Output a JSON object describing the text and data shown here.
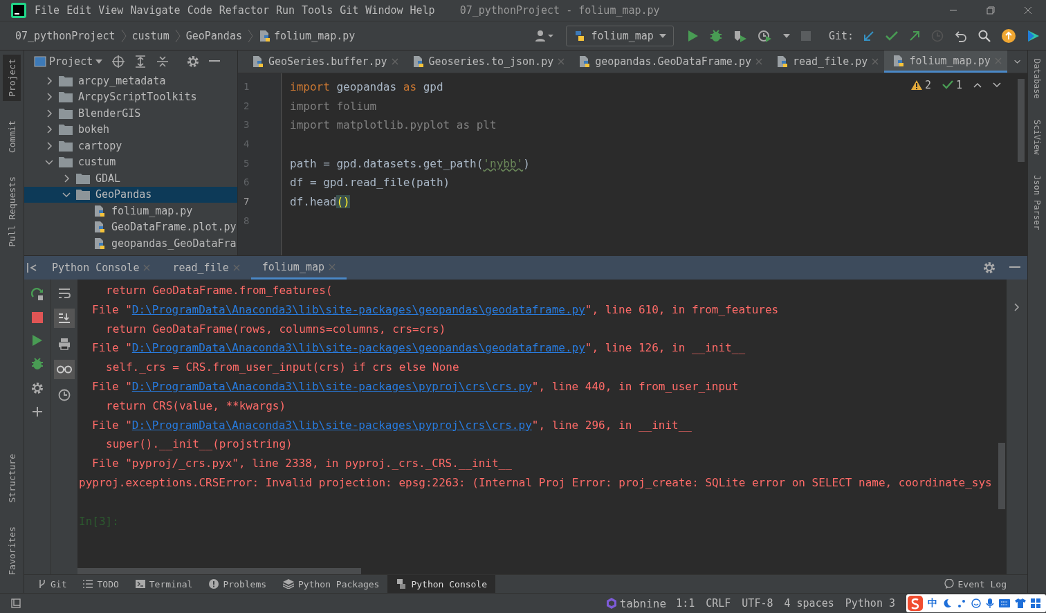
{
  "window": {
    "title": "07_pythonProject - folium_map.py"
  },
  "menu": [
    "File",
    "Edit",
    "View",
    "Navigate",
    "Code",
    "Refactor",
    "Run",
    "Tools",
    "Git",
    "Window",
    "Help"
  ],
  "breadcrumbs": [
    {
      "label": "07_pythonProject",
      "kind": "folder"
    },
    {
      "label": "custum",
      "kind": "folder"
    },
    {
      "label": "GeoPandas",
      "kind": "folder"
    },
    {
      "label": "folium_map.py",
      "kind": "file"
    }
  ],
  "run_config": {
    "label": "folium_map"
  },
  "git_label": "Git:",
  "left_strip_top": [
    {
      "label": "Project",
      "selected": true
    },
    {
      "label": "Commit",
      "selected": false
    },
    {
      "label": "Pull Requests",
      "selected": false
    }
  ],
  "left_strip_bottom": [
    {
      "label": "Structure",
      "selected": false
    },
    {
      "label": "Favorites",
      "selected": false
    }
  ],
  "right_strip": [
    {
      "label": "Database"
    },
    {
      "label": "SciView"
    },
    {
      "label": "Json Parser"
    }
  ],
  "project_panel": {
    "title": "Project",
    "tree": [
      {
        "label": "arcpy_metadata",
        "kind": "folder",
        "expanded": false,
        "selected": false
      },
      {
        "label": "ArcpyScriptToolkits",
        "kind": "folder",
        "expanded": false,
        "selected": false
      },
      {
        "label": "BlenderGIS",
        "kind": "folder",
        "expanded": false,
        "selected": false
      },
      {
        "label": "bokeh",
        "kind": "folder",
        "expanded": false,
        "selected": false
      },
      {
        "label": "cartopy",
        "kind": "folder",
        "expanded": false,
        "selected": false
      },
      {
        "label": "custum",
        "kind": "folder",
        "expanded": true,
        "selected": false,
        "children": [
          {
            "label": "GDAL",
            "kind": "folder",
            "expanded": false,
            "selected": false
          },
          {
            "label": "GeoPandas",
            "kind": "folder",
            "expanded": true,
            "selected": true,
            "children": [
              {
                "label": "folium_map.py",
                "kind": "file",
                "selected": false
              },
              {
                "label": "GeoDataFrame.plot.py",
                "kind": "file",
                "selected": false
              },
              {
                "label": "geopandas_GeoDataFra",
                "kind": "file",
                "selected": false
              }
            ]
          }
        ]
      }
    ]
  },
  "editor": {
    "tabs": [
      {
        "label": "GeoSeries.buffer.py",
        "selected": false
      },
      {
        "label": "Geoseries.to_json.py",
        "selected": false
      },
      {
        "label": "geopandas.GeoDataFrame.py",
        "selected": false
      },
      {
        "label": "read_file.py",
        "selected": false
      },
      {
        "label": "folium_map.py",
        "selected": true
      }
    ],
    "warnings": "2",
    "weak_warnings": "1",
    "lines": [
      {
        "number": "1",
        "current": false,
        "tokens": [
          {
            "t": "import",
            "kind": "keyword"
          },
          {
            "t": " geopandas ",
            "kind": "plain"
          },
          {
            "t": "as",
            "kind": "keyword"
          },
          {
            "t": " gpd",
            "kind": "plain"
          }
        ]
      },
      {
        "number": "2",
        "current": false,
        "tokens": [
          {
            "t": "import folium",
            "kind": "unused"
          }
        ]
      },
      {
        "number": "3",
        "current": false,
        "tokens": [
          {
            "t": "import matplotlib.pyplot as plt",
            "kind": "unused"
          }
        ]
      },
      {
        "number": "4",
        "current": false
      },
      {
        "number": "5",
        "current": false,
        "tokens": [
          {
            "t": "path = gpd.datasets.get_path(",
            "kind": "plain"
          },
          {
            "t": "'nybb'",
            "kind": "string"
          },
          {
            "t": ")",
            "kind": "plain"
          }
        ]
      },
      {
        "number": "6",
        "current": false,
        "tokens": [
          {
            "t": "df = gpd.read_file(path)",
            "kind": "plain"
          }
        ]
      },
      {
        "number": "7",
        "current": true,
        "tokens": [
          {
            "t": "df.head",
            "kind": "plain"
          },
          {
            "t": "()",
            "kind": "match"
          }
        ]
      },
      {
        "number": "8",
        "current": false
      }
    ]
  },
  "console": {
    "tabs": [
      {
        "label": "Python Console",
        "selected": false
      },
      {
        "label": "read_file",
        "selected": false
      },
      {
        "label": "folium_map",
        "selected": true
      }
    ],
    "lines": [
      {
        "kind": "code",
        "text": "return GeoDataFrame.from_features("
      },
      {
        "kind": "file",
        "before": "File \"",
        "link": "D:\\ProgramData\\Anaconda3\\lib\\site-packages\\geopandas\\geodataframe.py",
        "after": "\", line 610, in from_features"
      },
      {
        "kind": "code",
        "text": "return GeoDataFrame(rows, columns=columns, crs=crs)"
      },
      {
        "kind": "file",
        "before": "File \"",
        "link": "D:\\ProgramData\\Anaconda3\\lib\\site-packages\\geopandas\\geodataframe.py",
        "after": "\", line 126, in __init__"
      },
      {
        "kind": "code",
        "text": "self._crs = CRS.from_user_input(crs) if crs else None"
      },
      {
        "kind": "file",
        "before": "File \"",
        "link": "D:\\ProgramData\\Anaconda3\\lib\\site-packages\\pyproj\\crs\\crs.py",
        "after": "\", line 440, in from_user_input"
      },
      {
        "kind": "code",
        "text": "return CRS(value, **kwargs)"
      },
      {
        "kind": "file",
        "before": "File \"",
        "link": "D:\\ProgramData\\Anaconda3\\lib\\site-packages\\pyproj\\crs\\crs.py",
        "after": "\", line 296, in __init__"
      },
      {
        "kind": "code",
        "text": "super().__init__(projstring)"
      },
      {
        "kind": "plainfile",
        "text": "File \"pyproj/_crs.pyx\", line 2338, in pyproj._crs._CRS.__init__"
      },
      {
        "kind": "error",
        "text": "pyproj.exceptions.CRSError: Invalid projection: epsg:2263: (Internal Proj Error: proj_create: SQLite error on SELECT name, coordinate_sys"
      },
      {
        "kind": "blank"
      },
      {
        "kind": "prompt",
        "text": "In[3]:"
      }
    ]
  },
  "tool_tabs": [
    {
      "label": "Git",
      "selected": false
    },
    {
      "label": "TODO",
      "selected": false
    },
    {
      "label": "Terminal",
      "selected": false
    },
    {
      "label": "Problems",
      "selected": false
    },
    {
      "label": "Python Packages",
      "selected": false
    },
    {
      "label": "Python Console",
      "selected": true
    }
  ],
  "event_log": "Event Log",
  "status": {
    "brand": "tabnine",
    "items": [
      "1:1",
      "CRLF",
      "UTF-8",
      "4 spaces",
      "Python 3"
    ]
  },
  "ime": {
    "label": "中"
  }
}
